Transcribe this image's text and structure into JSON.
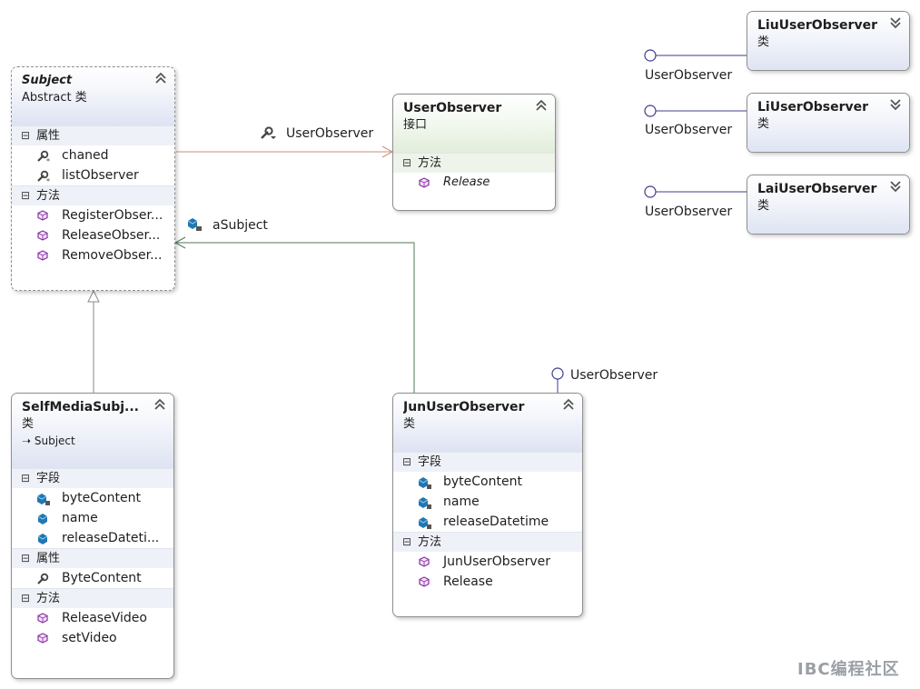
{
  "classes": {
    "subject": {
      "name": "Subject",
      "stereotype": "Abstract 类",
      "sections": [
        {
          "label": "属性",
          "members": [
            "chaned",
            "listObserver"
          ]
        },
        {
          "label": "方法",
          "members": [
            "RegisterObser...",
            "ReleaseObser...",
            "RemoveObser..."
          ]
        }
      ]
    },
    "userobserver": {
      "name": "UserObserver",
      "stereotype": "接口",
      "sections": [
        {
          "label": "方法",
          "members": [
            "Release"
          ]
        }
      ]
    },
    "liuuserobserver": {
      "name": "LiuUserObserver",
      "stereotype": "类"
    },
    "liuserobserver": {
      "name": "LiUserObserver",
      "stereotype": "类"
    },
    "laiuserobserver": {
      "name": "LaiUserObserver",
      "stereotype": "类"
    },
    "selfmediasubject": {
      "name": "SelfMediaSubj...",
      "stereotype": "类",
      "base": "Subject",
      "sections": [
        {
          "label": "字段",
          "members": [
            "byteContent",
            "name",
            "releaseDateti..."
          ]
        },
        {
          "label": "属性",
          "members": [
            "ByteContent"
          ]
        },
        {
          "label": "方法",
          "members": [
            "ReleaseVideo",
            "setVideo"
          ]
        }
      ]
    },
    "junuserobserver": {
      "name": "JunUserObserver",
      "stereotype": "类",
      "sections": [
        {
          "label": "字段",
          "members": [
            "byteContent",
            "name",
            "releaseDatetime"
          ]
        },
        {
          "label": "方法",
          "members": [
            "JunUserObserver",
            "Release"
          ]
        }
      ]
    }
  },
  "associations": {
    "userobserver_label": "UserObserver",
    "asubject_label": "aSubject"
  },
  "lollipops": {
    "liu": "UserObserver",
    "li": "UserObserver",
    "lai": "UserObserver",
    "jun": "UserObserver"
  },
  "watermark": "IBC编程社区",
  "colors": {
    "header_blue": "#dde3f2",
    "header_green": "#e1edda",
    "association_line": "#c8907a",
    "navigation_line": "#4e7a55",
    "lollipop": "#3c3c8c"
  }
}
